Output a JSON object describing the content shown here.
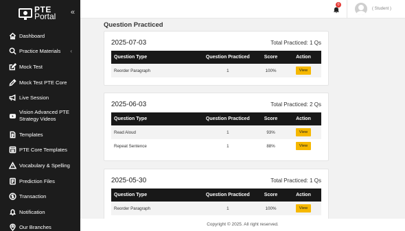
{
  "brand": {
    "line1": "PTE",
    "line2": "Portal",
    "collapse_glyph": "«"
  },
  "sidebar": {
    "items": [
      {
        "label": "Dashboard",
        "icon": "home-icon"
      },
      {
        "label": "Practice Materials",
        "icon": "search-icon",
        "arrow": "‹"
      },
      {
        "label": "Mock Test",
        "icon": "edit-icon"
      },
      {
        "label": "Mock Test PTE Core",
        "icon": "pencil-icon"
      },
      {
        "label": "Live Session",
        "icon": "megaphone-icon"
      },
      {
        "label": "Vision Advanced PTE Strategy Videos",
        "icon": "youtube-icon"
      },
      {
        "label": "Templates",
        "icon": "document-icon"
      },
      {
        "label": "PTE Core Templates",
        "icon": "template-icon"
      },
      {
        "label": "Vocabulary & Spelling",
        "icon": "warning-icon"
      },
      {
        "label": "Prediction Files",
        "icon": "file-icon"
      },
      {
        "label": "Transaction",
        "icon": "dollar-icon"
      },
      {
        "label": "Notification",
        "icon": "bell-icon"
      },
      {
        "label": "Our Branches",
        "icon": "location-icon"
      }
    ]
  },
  "header": {
    "notification_count": "0",
    "username": "( Student )"
  },
  "main": {
    "section_title": "Question Practiced",
    "columns": [
      "Question Type",
      "Question Practiced",
      "Score",
      "Action"
    ],
    "action_label": "View",
    "cards": [
      {
        "date": "2025-07-03",
        "total": "Total Practiced: 1 Qs",
        "rows": [
          {
            "type": "Reorder Paragraph",
            "practiced": "1",
            "score": "100%"
          }
        ]
      },
      {
        "date": "2025-06-03",
        "total": "Total Practiced: 2 Qs",
        "rows": [
          {
            "type": "Read Aloud",
            "practiced": "1",
            "score": "93%"
          },
          {
            "type": "Repeat Sentence",
            "practiced": "1",
            "score": "88%"
          }
        ]
      },
      {
        "date": "2025-05-30",
        "total": "Total Practiced: 1 Qs",
        "rows": [
          {
            "type": "Reorder Paragraph",
            "practiced": "1",
            "score": "100%"
          }
        ]
      }
    ]
  },
  "footer": {
    "text": "Copyright © 2025. All right reserved."
  }
}
